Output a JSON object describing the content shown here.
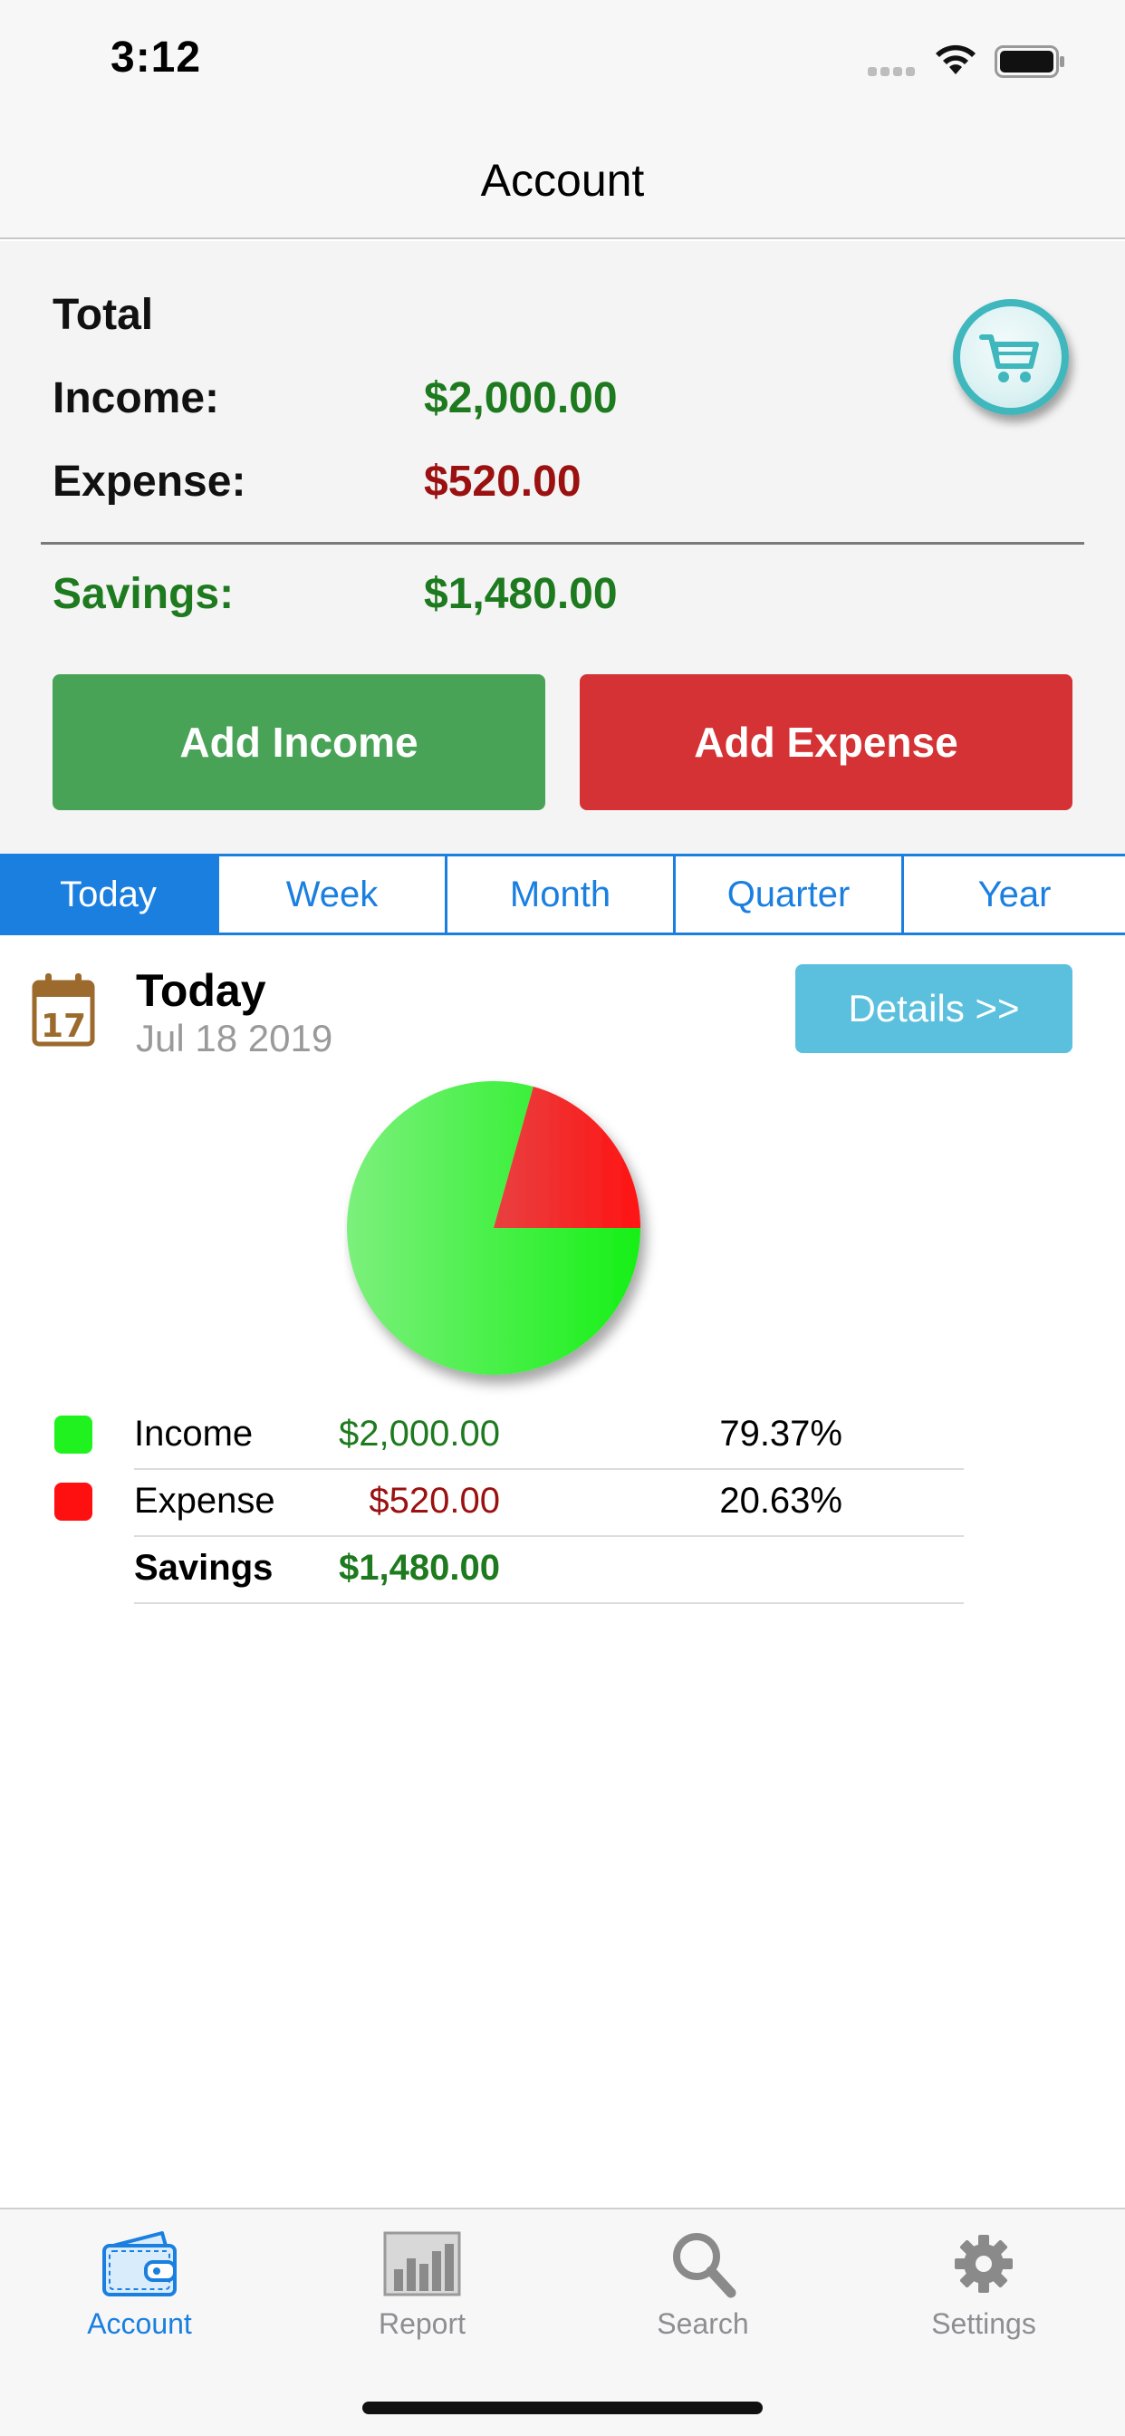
{
  "status_bar": {
    "time": "3:12"
  },
  "nav": {
    "title": "Account"
  },
  "summary": {
    "total_label": "Total",
    "income_label": "Income:",
    "income_value": "$2,000.00",
    "expense_label": "Expense:",
    "expense_value": "$520.00",
    "savings_label": "Savings:",
    "savings_value": "$1,480.00"
  },
  "actions": {
    "add_income": "Add Income",
    "add_expense": "Add Expense"
  },
  "periods": {
    "tabs": [
      "Today",
      "Week",
      "Month",
      "Quarter",
      "Year"
    ],
    "active": "Today"
  },
  "period_header": {
    "calendar_day": "17",
    "title": "Today",
    "date": "Jul 18 2019",
    "details_label": "Details >>"
  },
  "legend": {
    "income": {
      "label": "Income",
      "amount": "$2,000.00",
      "percent": "79.37%"
    },
    "expense": {
      "label": "Expense",
      "amount": "$520.00",
      "percent": "20.63%"
    },
    "savings": {
      "label": "Savings",
      "amount": "$1,480.00"
    }
  },
  "chart_data": {
    "type": "pie",
    "categories": [
      "Income",
      "Expense"
    ],
    "values": [
      2000,
      520
    ],
    "percentages": [
      79.37,
      20.63
    ],
    "colors": [
      "#22ee22",
      "#ee1a1a"
    ]
  },
  "colors": {
    "accent": "#1b7fe0",
    "income_green": "#1e7a1e",
    "expense_red": "#9b1010",
    "add_income_bg": "#48a357",
    "add_expense_bg": "#d43234",
    "details_bg": "#5bc0de"
  },
  "tab_bar": {
    "items": [
      {
        "label": "Account",
        "icon": "wallet-icon"
      },
      {
        "label": "Report",
        "icon": "bar-chart-icon"
      },
      {
        "label": "Search",
        "icon": "search-icon"
      },
      {
        "label": "Settings",
        "icon": "gear-icon"
      }
    ]
  }
}
